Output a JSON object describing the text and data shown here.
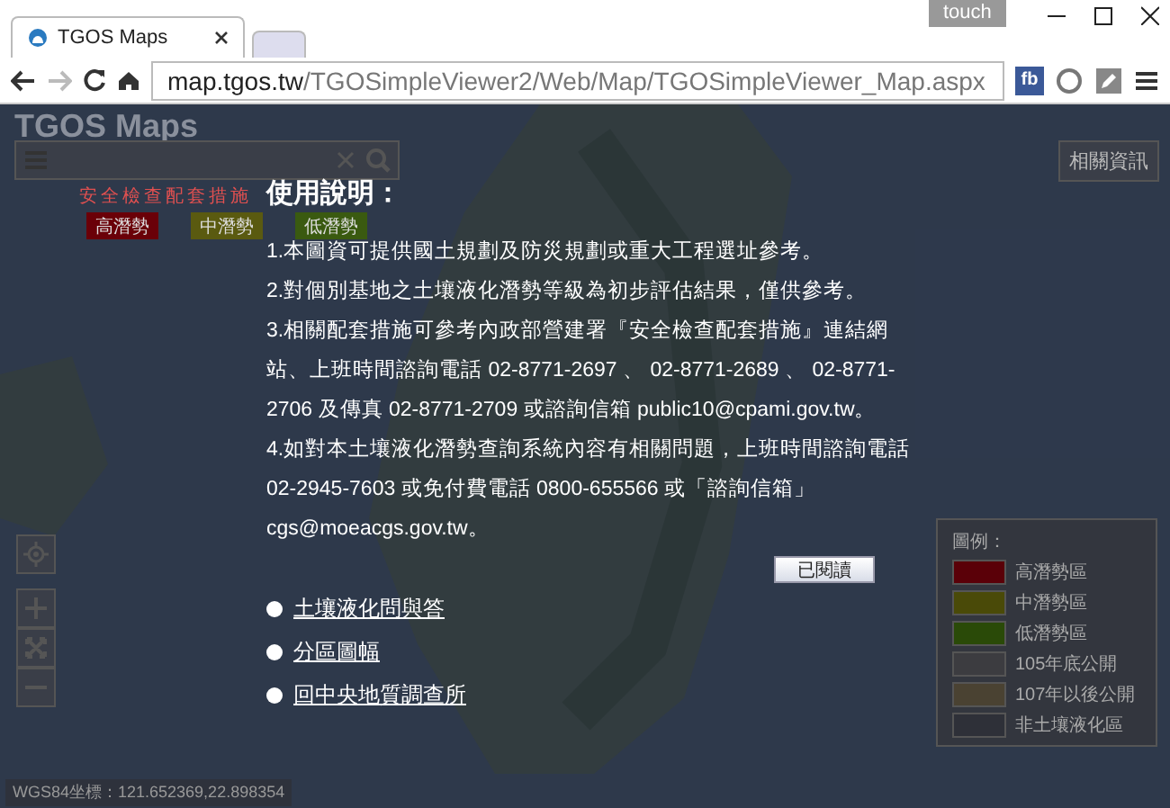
{
  "window": {
    "user_badge": "touch",
    "tabs": [
      {
        "title": "TGOS Maps",
        "selected": true
      },
      {
        "selected": false
      }
    ]
  },
  "toolbar": {
    "url_host": "map.tgos.tw",
    "url_path": "/TGOSimpleViewer2/Web/Map/TGOSimpleViewer_Map.aspx",
    "extension_label": "fb"
  },
  "map": {
    "title": "TGOS Maps",
    "info_button": "相關資訊",
    "banner": "安全檢查配套措施",
    "level_buttons": [
      {
        "label": "高潛勢",
        "color": "#6a0008"
      },
      {
        "label": "中潛勢",
        "color": "#5a5a10"
      },
      {
        "label": "低潛勢",
        "color": "#3a5a10"
      }
    ],
    "legend": {
      "title": "圖例：",
      "items": [
        {
          "label": "高潛勢區",
          "color": "#5a0008"
        },
        {
          "label": "中潛勢區",
          "color": "#4a4a08"
        },
        {
          "label": "低潛勢區",
          "color": "#2a4a08"
        },
        {
          "label": "105年底公開",
          "color": "#3c3c40"
        },
        {
          "label": "107年以後公開",
          "color": "#4a4232"
        },
        {
          "label": "非土壤液化區",
          "color": "#2e3038"
        }
      ]
    },
    "coordinates": "WGS84坐標：121.652369,22.898354"
  },
  "dialog": {
    "title": "使用說明：",
    "paragraphs": [
      "1.本圖資可提供國土規劃及防災規劃或重大工程選址參考。",
      "2.對個別基地之土壤液化潛勢等級為初步評估結果，僅供參考。",
      "3.相關配套措施可參考內政部營建署『安全檢查配套措施』連結網站、上班時間諮詢電話 02-8771-2697 、 02-8771-2689 、 02-8771-2706 及傳真 02-8771-2709 或諮詢信箱 public10@cpami.gov.tw。",
      "4.如對本土壤液化潛勢查詢系統內容有相關問題，上班時間諮詢電話 02-2945-7603 或免付費電話 0800-655566 或「諮詢信箱」 cgs@moeacgs.gov.tw。"
    ],
    "button": "已閱讀",
    "links": [
      "土壤液化問與答",
      "分區圖幅",
      "回中央地質調查所"
    ]
  }
}
